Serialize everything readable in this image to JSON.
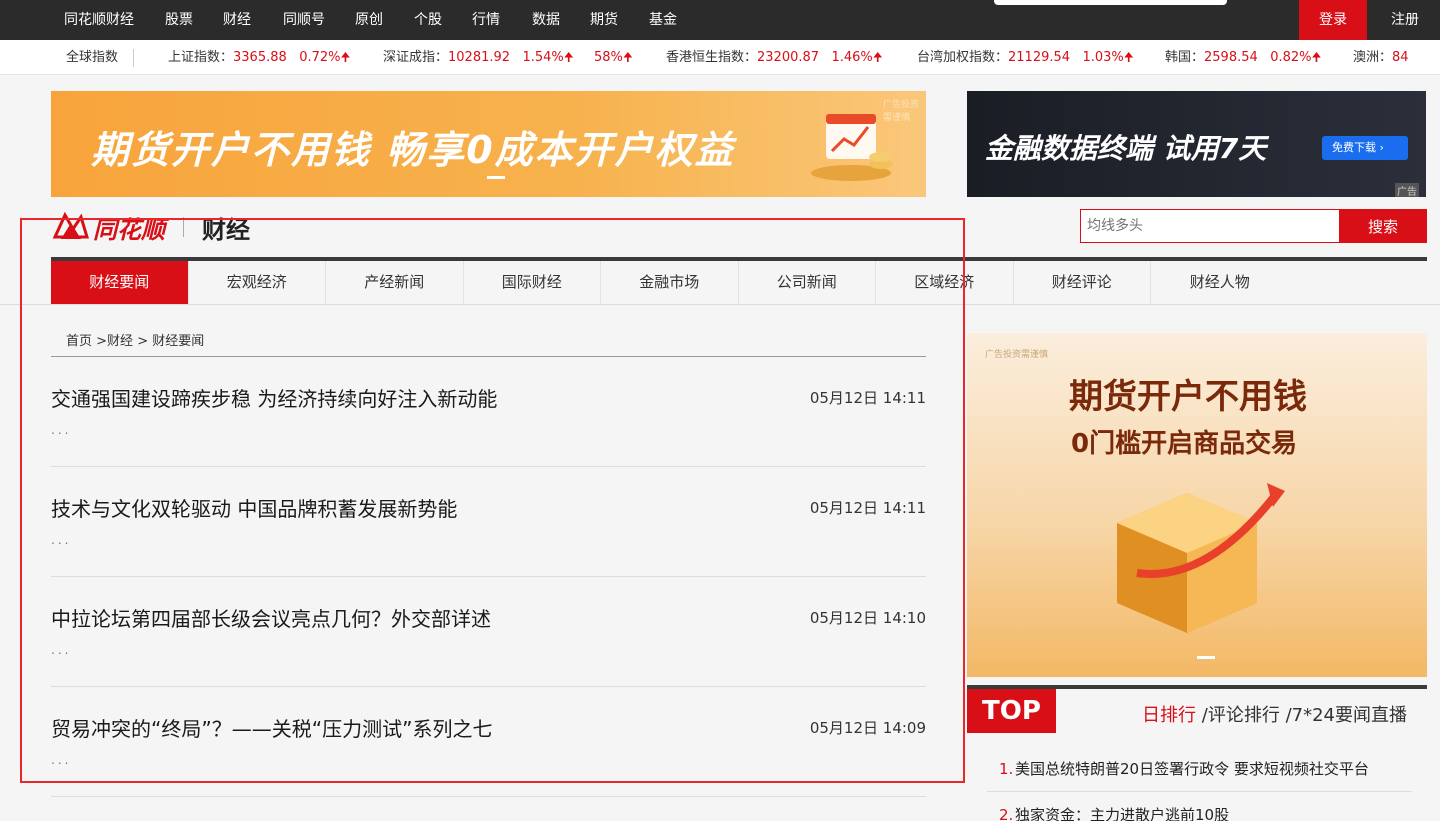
{
  "topnav": {
    "links": [
      "同花顺财经",
      "股票",
      "财经",
      "同顺号",
      "原创",
      "个股",
      "行情",
      "数据",
      "期货",
      "基金"
    ],
    "login": "登录",
    "register": "注册"
  },
  "ticker": {
    "label": "全球指数",
    "items": [
      {
        "name": "上证指数：",
        "value": "3365.88",
        "change": "0.72%"
      },
      {
        "name": "深证成指：",
        "value": "10281.92",
        "change": "1.54%"
      },
      {
        "name": "",
        "value": "",
        "change": "58%"
      },
      {
        "name": "香港恒生指数：",
        "value": "23200.87",
        "change": "1.46%"
      },
      {
        "name": "台湾加权指数：",
        "value": "21129.54",
        "change": "1.03%"
      },
      {
        "name": "韩国：",
        "value": "2598.54",
        "change": "0.82%"
      },
      {
        "name": "澳洲：",
        "value": "84",
        "change": ""
      }
    ]
  },
  "ads": {
    "top_left": "期货开户不用钱  畅享0成本开户权益",
    "top_left_note": "广告投资需谨慎",
    "top_right": "金融数据终端 试用7天",
    "top_right_button": "免费下载",
    "top_right_tag": "广告",
    "side_note": "广告投资需谨慎",
    "side_line1": "期货开户不用钱",
    "side_line2": "0门槛开启商品交易"
  },
  "logo": {
    "brand": "同花顺",
    "section": "财经"
  },
  "search": {
    "placeholder": "均线多头",
    "button": "搜索"
  },
  "tabs": [
    "财经要闻",
    "宏观经济",
    "产经新闻",
    "国际财经",
    "金融市场",
    "公司新闻",
    "区域经济",
    "财经评论",
    "财经人物"
  ],
  "breadcrumb": {
    "home": "首页",
    "sep1": " >",
    "level1": "财经",
    "sep2": " > ",
    "current": "财经要闻"
  },
  "news": [
    {
      "title": "交通强国建设蹄疾步稳 为经济持续向好注入新动能",
      "time": "05月12日 14:11",
      "more": "..."
    },
    {
      "title": "技术与文化双轮驱动 中国品牌积蓄发展新势能",
      "time": "05月12日 14:11",
      "more": "..."
    },
    {
      "title": "中拉论坛第四届部长级会议亮点几何？外交部详述",
      "time": "05月12日 14:10",
      "more": "..."
    },
    {
      "title": "贸易冲突的“终局”？——关税“压力测试”系列之七",
      "time": "05月12日 14:09",
      "more": "..."
    }
  ],
  "top": {
    "label": "TOP",
    "tab1": "日排行",
    "tab2": "评论排行",
    "tab3": "7*24要闻直播",
    "sep": " /",
    "items": [
      {
        "num": "1.",
        "text": "美国总统特朗普20日签署行政令 要求短视频社交平台"
      },
      {
        "num": "2.",
        "text": "独家资金：主力进散户逃前10股"
      }
    ]
  },
  "colors": {
    "accent": "#d80f17",
    "nav_bg": "#2b2b2b",
    "highlight": "#e9262a"
  }
}
